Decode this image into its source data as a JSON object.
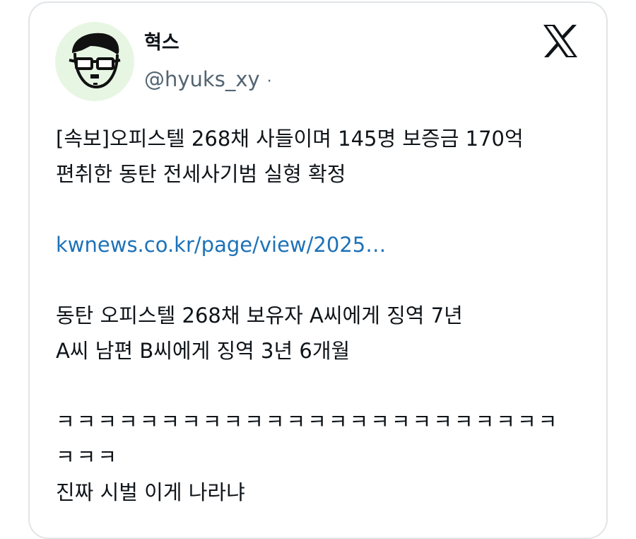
{
  "author": {
    "display_name": "혁스",
    "handle": "@hyuks_xy",
    "separator": "·",
    "avatar_icon": "avatar-face-mustache-glasses",
    "avatar_bg": "#e7f6e3"
  },
  "platform": {
    "logo_icon": "x-logo-icon"
  },
  "tweet": {
    "headline_line1": "[속보]오피스텔 268채 사들이며 145명 보증금 170억",
    "headline_line2": "편취한 동탄 전세사기범 실형 확정",
    "link_text": "kwnews.co.kr/page/view/2025…",
    "detail_line1": "동탄 오피스텔 268채 보유자 A씨에게 징역 7년",
    "detail_line2": "A씨 남편 B씨에게 징역 3년 6개월",
    "laugh_line1": "ㅋㅋㅋㅋㅋㅋㅋㅋㅋㅋㅋㅋㅋㅋㅋㅋㅋㅋㅋㅋㅋㅋㅋㅋ",
    "laugh_line2": "ㅋㅋㅋ",
    "closing_line": "진짜 시벌 이게 나라냐"
  },
  "colors": {
    "text": "#0f1419",
    "secondary_text": "#536471",
    "link": "#1d72b8",
    "border": "#e1e5e8"
  }
}
